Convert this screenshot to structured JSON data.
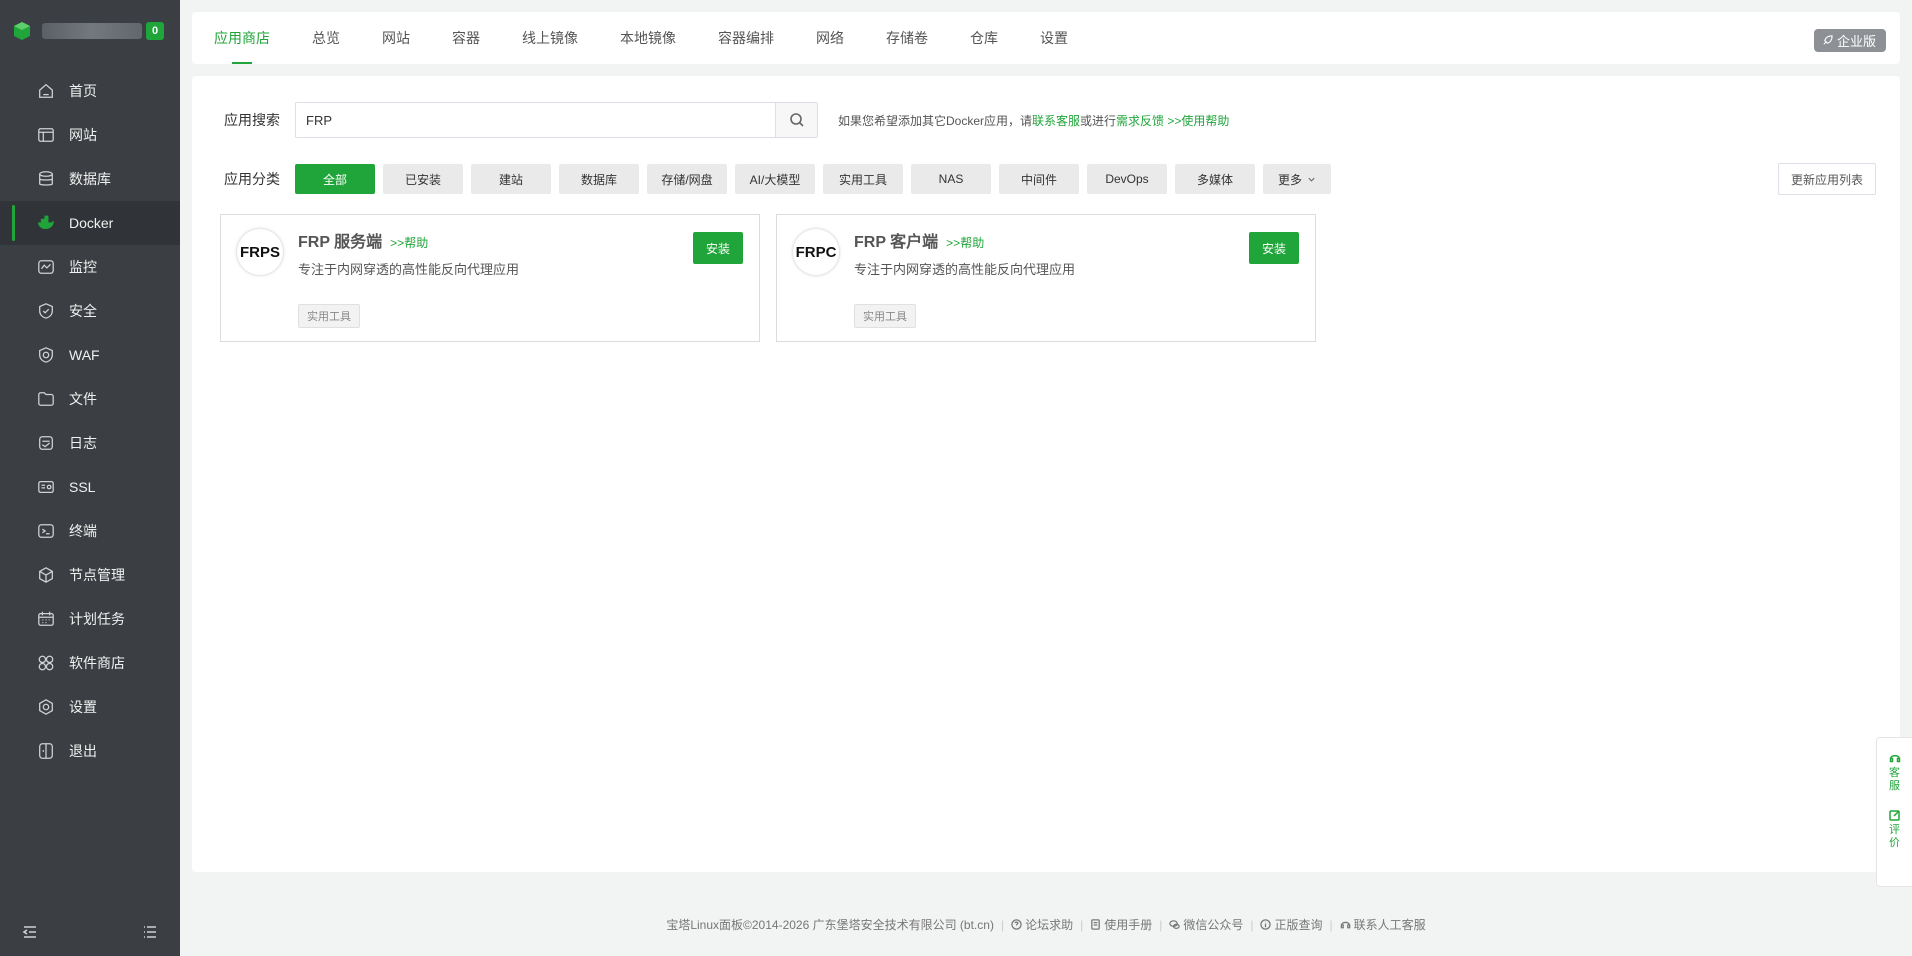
{
  "brand": {
    "badge": "0"
  },
  "sidebar": {
    "items": [
      {
        "label": "首页",
        "icon": "home-icon"
      },
      {
        "label": "网站",
        "icon": "website-icon"
      },
      {
        "label": "数据库",
        "icon": "database-icon"
      },
      {
        "label": "Docker",
        "icon": "docker-icon",
        "active": true
      },
      {
        "label": "监控",
        "icon": "monitor-icon"
      },
      {
        "label": "安全",
        "icon": "shield-icon"
      },
      {
        "label": "WAF",
        "icon": "waf-icon"
      },
      {
        "label": "文件",
        "icon": "folder-icon"
      },
      {
        "label": "日志",
        "icon": "log-icon"
      },
      {
        "label": "SSL",
        "icon": "ssl-icon"
      },
      {
        "label": "终端",
        "icon": "terminal-icon"
      },
      {
        "label": "节点管理",
        "icon": "node-icon"
      },
      {
        "label": "计划任务",
        "icon": "calendar-icon"
      },
      {
        "label": "软件商店",
        "icon": "store-icon"
      },
      {
        "label": "设置",
        "icon": "gear-icon"
      },
      {
        "label": "退出",
        "icon": "logout-icon"
      }
    ]
  },
  "tabs": [
    "应用商店",
    "总览",
    "网站",
    "容器",
    "线上镜像",
    "本地镜像",
    "容器编排",
    "网络",
    "存储卷",
    "仓库",
    "设置"
  ],
  "enterprise_label": "企业版",
  "search": {
    "label": "应用搜索",
    "value": "FRP",
    "hint_prefix": "如果您希望添加其它Docker应用，请",
    "hint_link1": "联系客服",
    "hint_mid": "或进行",
    "hint_link2": "需求反馈",
    "hint_link3": ">>使用帮助"
  },
  "categories": {
    "label": "应用分类",
    "items": [
      "全部",
      "已安装",
      "建站",
      "数据库",
      "存储/网盘",
      "AI/大模型",
      "实用工具",
      "NAS",
      "中间件",
      "DevOps",
      "多媒体"
    ],
    "more": "更多",
    "refresh": "更新应用列表"
  },
  "apps": [
    {
      "logo": "FRPS",
      "name": "FRP 服务端",
      "help": ">>帮助",
      "desc": "专注于内网穿透的高性能反向代理应用",
      "tag": "实用工具",
      "install": "安装"
    },
    {
      "logo": "FRPC",
      "name": "FRP 客户端",
      "help": ">>帮助",
      "desc": "专注于内网穿透的高性能反向代理应用",
      "tag": "实用工具",
      "install": "安装"
    }
  ],
  "footer": {
    "copyright": "宝塔Linux面板©2014-2026 广东堡塔安全技术有限公司 (bt.cn)",
    "links": [
      "论坛求助",
      "使用手册",
      "微信公众号",
      "正版查询",
      "联系人工客服"
    ]
  },
  "float": {
    "service": "客服",
    "review": "评价"
  },
  "colors": {
    "accent": "#20a53a",
    "sidebar": "#3b3f44"
  }
}
